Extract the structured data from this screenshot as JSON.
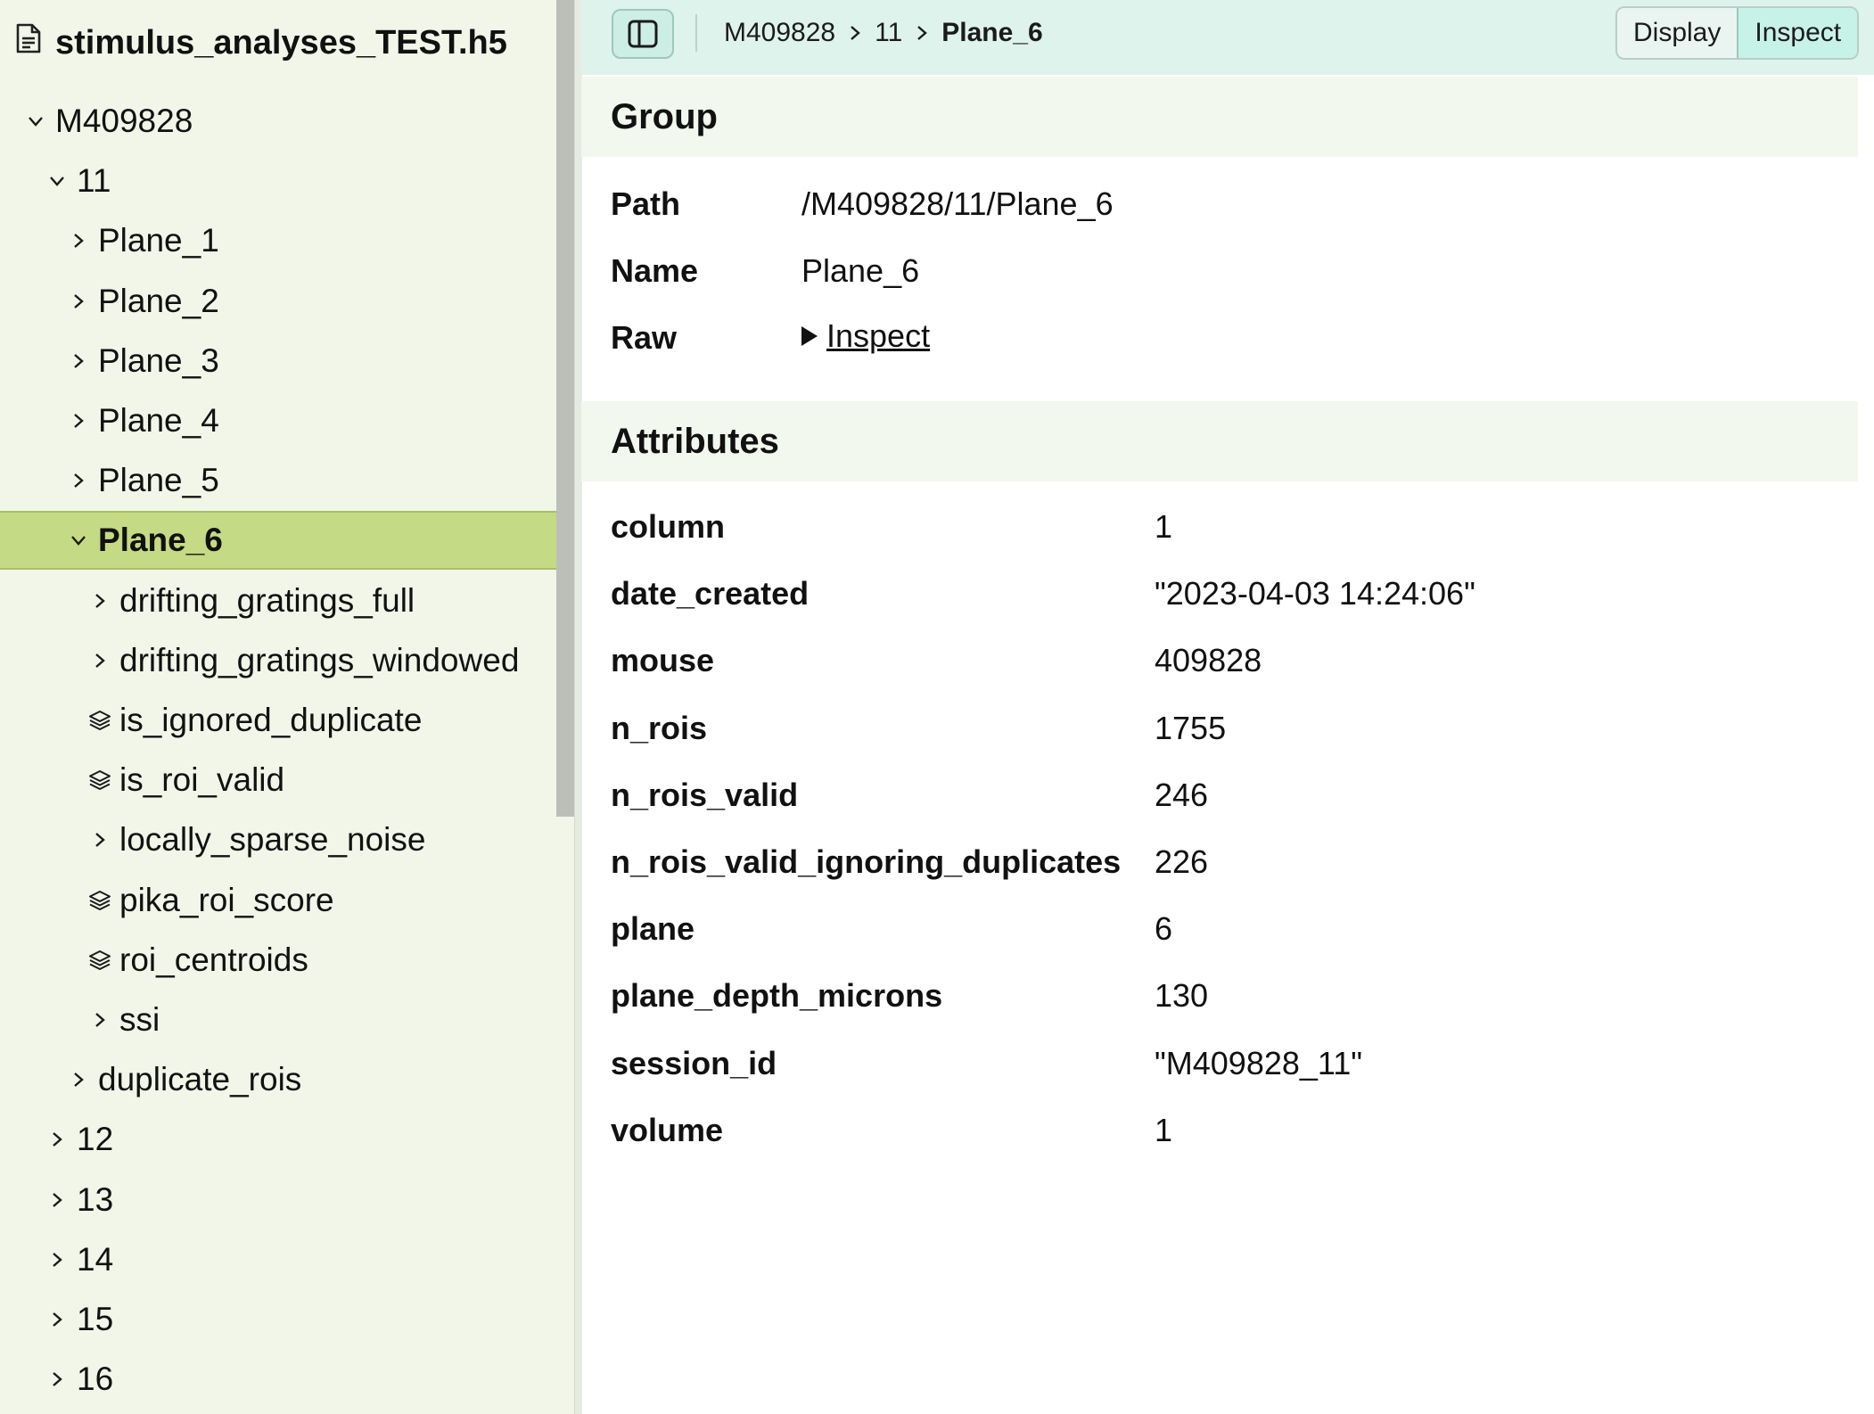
{
  "sidebar": {
    "file_name": "stimulus_analyses_TEST.h5",
    "tree": [
      {
        "label": "M409828",
        "level": 0,
        "icon": "chevron-down-icon",
        "selected": false
      },
      {
        "label": "11",
        "level": 1,
        "icon": "chevron-down-icon",
        "selected": false
      },
      {
        "label": "Plane_1",
        "level": 2,
        "icon": "chevron-right-icon",
        "selected": false
      },
      {
        "label": "Plane_2",
        "level": 2,
        "icon": "chevron-right-icon",
        "selected": false
      },
      {
        "label": "Plane_3",
        "level": 2,
        "icon": "chevron-right-icon",
        "selected": false
      },
      {
        "label": "Plane_4",
        "level": 2,
        "icon": "chevron-right-icon",
        "selected": false
      },
      {
        "label": "Plane_5",
        "level": 2,
        "icon": "chevron-right-icon",
        "selected": false
      },
      {
        "label": "Plane_6",
        "level": 2,
        "icon": "chevron-down-icon",
        "selected": true
      },
      {
        "label": "drifting_gratings_full",
        "level": 3,
        "icon": "chevron-right-icon",
        "selected": false
      },
      {
        "label": "drifting_gratings_windowed",
        "level": 3,
        "icon": "chevron-right-icon",
        "selected": false
      },
      {
        "label": "is_ignored_duplicate",
        "level": 3,
        "icon": "dataset-stack-icon",
        "selected": false
      },
      {
        "label": "is_roi_valid",
        "level": 3,
        "icon": "dataset-stack-icon",
        "selected": false
      },
      {
        "label": "locally_sparse_noise",
        "level": 3,
        "icon": "chevron-right-icon",
        "selected": false
      },
      {
        "label": "pika_roi_score",
        "level": 3,
        "icon": "dataset-stack-icon",
        "selected": false
      },
      {
        "label": "roi_centroids",
        "level": 3,
        "icon": "dataset-stack-icon",
        "selected": false
      },
      {
        "label": "ssi",
        "level": 3,
        "icon": "chevron-right-icon",
        "selected": false
      },
      {
        "label": "duplicate_rois",
        "level": 2,
        "icon": "chevron-right-icon",
        "selected": false
      },
      {
        "label": "12",
        "level": 1,
        "icon": "chevron-right-icon",
        "selected": false
      },
      {
        "label": "13",
        "level": 1,
        "icon": "chevron-right-icon",
        "selected": false
      },
      {
        "label": "14",
        "level": 1,
        "icon": "chevron-right-icon",
        "selected": false
      },
      {
        "label": "15",
        "level": 1,
        "icon": "chevron-right-icon",
        "selected": false
      },
      {
        "label": "16",
        "level": 1,
        "icon": "chevron-right-icon",
        "selected": false
      }
    ]
  },
  "toolbar": {
    "breadcrumb": [
      "M409828",
      "11",
      "Plane_6"
    ],
    "display_label": "Display",
    "inspect_label": "Inspect"
  },
  "group": {
    "heading": "Group",
    "path_label": "Path",
    "path_value": "/M409828/11/Plane_6",
    "name_label": "Name",
    "name_value": "Plane_6",
    "raw_label": "Raw",
    "raw_link": "Inspect"
  },
  "attributes": {
    "heading": "Attributes",
    "rows": [
      {
        "key": "column",
        "value": "1"
      },
      {
        "key": "date_created",
        "value": "\"2023-04-03 14:24:06\""
      },
      {
        "key": "mouse",
        "value": "409828"
      },
      {
        "key": "n_rois",
        "value": "1755"
      },
      {
        "key": "n_rois_valid",
        "value": "246"
      },
      {
        "key": "n_rois_valid_ignoring_duplicates",
        "value": "226"
      },
      {
        "key": "plane",
        "value": "6"
      },
      {
        "key": "plane_depth_microns",
        "value": "130"
      },
      {
        "key": "session_id",
        "value": "\"M409828_11\""
      },
      {
        "key": "volume",
        "value": "1"
      }
    ]
  },
  "colors": {
    "sidebar_bg": "#f1f6e9",
    "selected_bg": "#c4da84",
    "toolbar_bg": "#def3ec",
    "active_toggle_bg": "#c7f2e7",
    "section_bg": "#f3f8ee"
  }
}
